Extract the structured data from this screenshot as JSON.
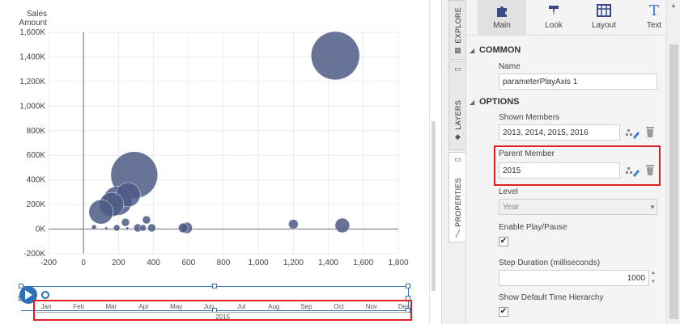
{
  "chart": {
    "y_axis_title_line1": "Sales",
    "y_axis_title_line2": "Amount"
  },
  "chart_data": {
    "type": "scatter",
    "bubble": true,
    "ylabel": "Sales Amount",
    "xlim": [
      -200,
      1800
    ],
    "ylim": [
      -200000,
      1600000
    ],
    "x_ticks": [
      "-200",
      "0",
      "200",
      "400",
      "600",
      "800",
      "1,000",
      "1,200",
      "1,400",
      "1,600",
      "1,800"
    ],
    "y_ticks": [
      "-200K",
      "0K",
      "200K",
      "400K",
      "600K",
      "800K",
      "1,000K",
      "1,200K",
      "1,400K",
      "1,600K"
    ],
    "color": "#4e5a86",
    "grid": true,
    "points": [
      {
        "x": 1440,
        "y": 1410000,
        "size": 30
      },
      {
        "x": 290,
        "y": 440000,
        "size": 29
      },
      {
        "x": 195,
        "y": 230000,
        "size": 18
      },
      {
        "x": 255,
        "y": 280000,
        "size": 15
      },
      {
        "x": 160,
        "y": 200000,
        "size": 15
      },
      {
        "x": 100,
        "y": 140000,
        "size": 15
      },
      {
        "x": 1480,
        "y": 30000,
        "size": 9
      },
      {
        "x": 1200,
        "y": 40000,
        "size": 6
      },
      {
        "x": 590,
        "y": 10000,
        "size": 7
      },
      {
        "x": 570,
        "y": 10000,
        "size": 6
      },
      {
        "x": 240,
        "y": 55000,
        "size": 5
      },
      {
        "x": 360,
        "y": 75000,
        "size": 5
      },
      {
        "x": 390,
        "y": 10000,
        "size": 5
      },
      {
        "x": 310,
        "y": 10000,
        "size": 5
      },
      {
        "x": 340,
        "y": 10000,
        "size": 4
      },
      {
        "x": 190,
        "y": 10000,
        "size": 4
      },
      {
        "x": 60,
        "y": 15000,
        "size": 3
      },
      {
        "x": 130,
        "y": 5000,
        "size": 2
      },
      {
        "x": 250,
        "y": 5000,
        "size": 2
      }
    ]
  },
  "play_axis": {
    "months": [
      "Jan",
      "Feb",
      "Mar",
      "Apr",
      "May",
      "Jun",
      "Jul",
      "Aug",
      "Sep",
      "Oct",
      "Nov",
      "Dec"
    ],
    "year": "2015",
    "position_fraction": 0.0
  },
  "vtabs": [
    {
      "label": "EXPLORE",
      "icon": "grid-icon"
    },
    {
      "label": "LAYERS",
      "icon": "layers-icon"
    },
    {
      "label": "PROPERTIES",
      "icon": "wrench-icon"
    }
  ],
  "toolbar": {
    "main": "Main",
    "look": "Look",
    "layout": "Layout",
    "text": "Text"
  },
  "common": {
    "title": "COMMON",
    "name_label": "Name",
    "name_value": "parameterPlayAxis 1"
  },
  "options": {
    "title": "OPTIONS",
    "shown_members_label": "Shown Members",
    "shown_members_value": "2013, 2014, 2015, 2016",
    "parent_member_label": "Parent Member",
    "parent_member_value": "2015",
    "level_label": "Level",
    "level_value": "Year",
    "enable_play_label": "Enable Play/Pause",
    "enable_play_checked": "✔",
    "step_duration_label": "Step Duration (milliseconds)",
    "step_duration_value": "1000",
    "show_default_label": "Show Default Time Hierarchy",
    "show_default_checked": "✔"
  },
  "colors": {
    "accent": "#2f6fb6",
    "highlight": "#e02020",
    "bubble": "#4e5a86"
  }
}
